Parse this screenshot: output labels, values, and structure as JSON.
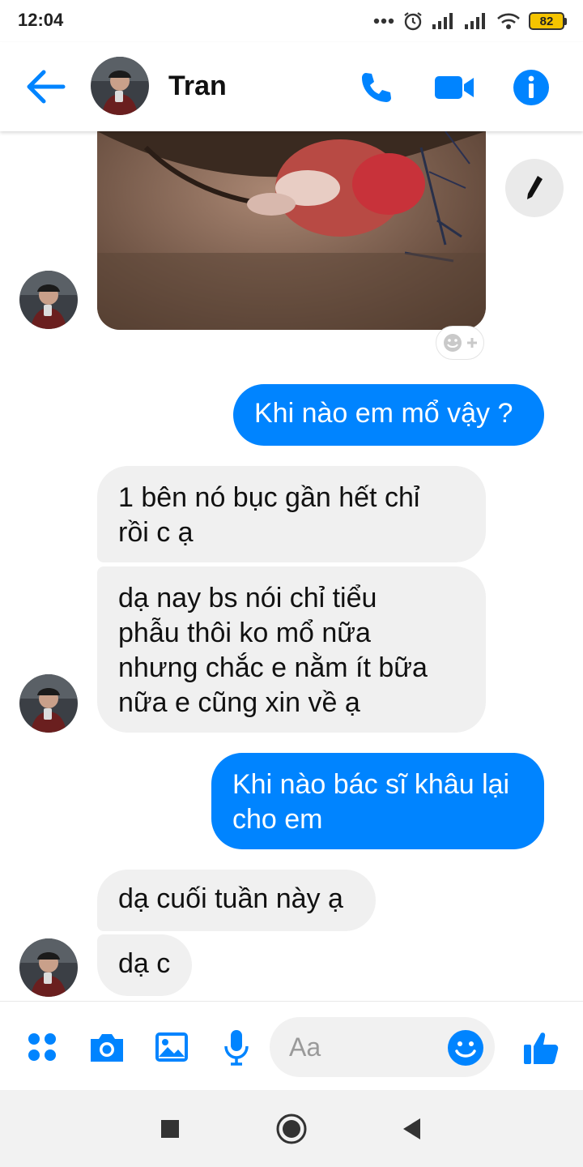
{
  "status_bar": {
    "time": "12:04",
    "battery": "82",
    "icons": [
      "more-dots-icon",
      "alarm-icon",
      "signal-icon",
      "signal-icon",
      "wifi-icon",
      "battery-icon"
    ]
  },
  "header": {
    "contact_name": "Tran",
    "icons": [
      "back-arrow-icon",
      "phone-icon",
      "video-camera-icon",
      "info-icon"
    ]
  },
  "messages": [
    {
      "from": "them",
      "type": "photo"
    },
    {
      "from": "me",
      "text": "Khi nào em mổ vậy ?"
    },
    {
      "from": "them",
      "text_lines": [
        "1 bên nó bục gần hết chỉ",
        "rồi c ạ"
      ]
    },
    {
      "from": "them",
      "text_lines": [
        "dạ nay bs nói chỉ tiểu",
        "phẫu thôi ko mổ nữa",
        "nhưng chắc e nằm ít bữa",
        "nữa e cũng xin về ạ"
      ]
    },
    {
      "from": "me",
      "text_lines": [
        "Khi nào bác sĩ khâu lại",
        "cho em"
      ]
    },
    {
      "from": "them",
      "text": "dạ cuối tuần này ạ"
    },
    {
      "from": "them",
      "text": "dạ c"
    }
  ],
  "composer": {
    "placeholder": "Aa",
    "icons": [
      "apps-grid-icon",
      "camera-icon",
      "image-icon",
      "microphone-icon",
      "emoji-icon",
      "thumbs-up-icon"
    ]
  },
  "colors": {
    "accent": "#0084ff",
    "incoming_bubble": "#f0f0f0",
    "battery": "#f5c400"
  }
}
